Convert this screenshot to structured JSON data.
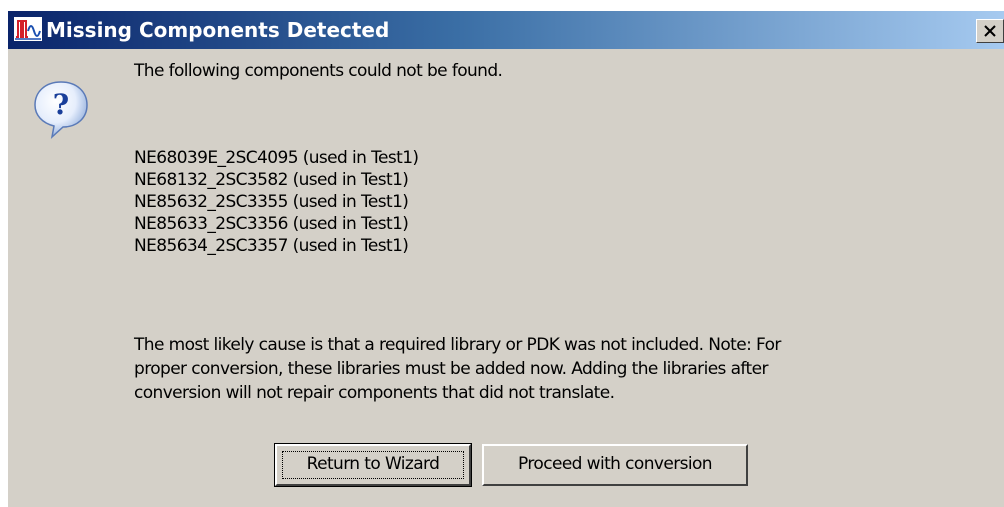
{
  "window": {
    "title": "Missing Components Detected",
    "app_icon": "waveform-app-icon",
    "close_icon": "close-icon",
    "close_label": "X"
  },
  "dialog": {
    "icon": "question-icon",
    "intro": "The following components could not be found.",
    "components": [
      "NE68039E_2SC4095 (used in Test1)",
      "NE68132_2SC3582 (used in Test1)",
      "NE85632_2SC3355 (used in Test1)",
      "NE85633_2SC3356 (used in Test1)",
      "NE85634_2SC3357 (used in Test1)"
    ],
    "cause_lines": [
      "The most likely cause is that a required library or PDK was not included.  Note: For",
      "proper conversion, these libraries must be added now.  Adding the libraries after",
      "conversion will not repair components that did not translate."
    ]
  },
  "buttons": {
    "return_label": "Return to Wizard",
    "proceed_label": "Proceed with conversion"
  },
  "colors": {
    "title_start": "#0a246a",
    "title_end": "#a6caf0",
    "face": "#d4d0c8",
    "icon_red": "#d4202a",
    "icon_blue": "#1a4fb0"
  }
}
